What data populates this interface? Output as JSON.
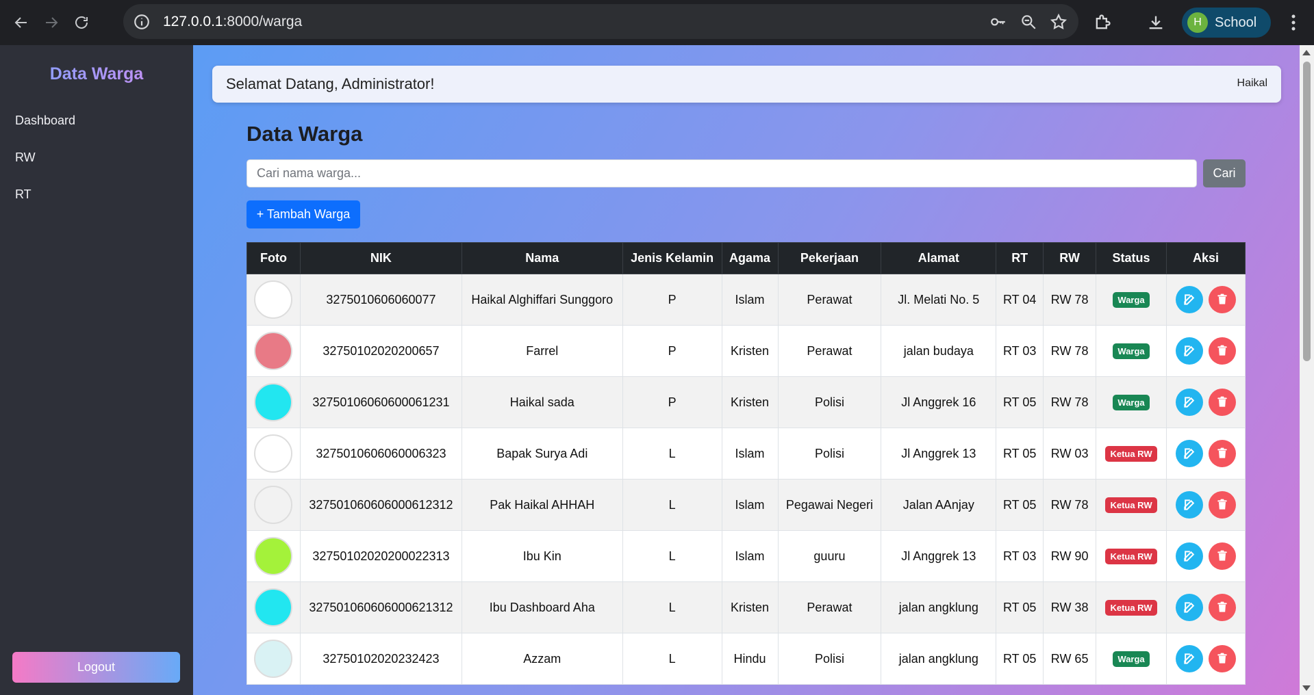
{
  "browser": {
    "url_host": "127.0.0.1",
    "url_path": ":8000/warga",
    "profile_initial": "H",
    "profile_name": "School"
  },
  "sidebar": {
    "brand": "Data Warga",
    "items": [
      {
        "label": "Dashboard"
      },
      {
        "label": "RW"
      },
      {
        "label": "RT"
      }
    ],
    "logout": "Logout"
  },
  "topbar": {
    "welcome": "Selamat Datang, Administrator!",
    "user": "Haikal"
  },
  "main": {
    "title": "Data Warga",
    "search_placeholder": "Cari nama warga...",
    "search_button": "Cari",
    "add_button": "+ Tambah Warga"
  },
  "table": {
    "headers": [
      "Foto",
      "NIK",
      "Nama",
      "Jenis Kelamin",
      "Agama",
      "Pekerjaan",
      "Alamat",
      "RT",
      "RW",
      "Status",
      "Aksi"
    ],
    "rows": [
      {
        "nik": "3275010606060077",
        "nama": "Haikal Alghiffari Sunggoro",
        "jk": "P",
        "agama": "Islam",
        "pekerjaan": "Perawat",
        "alamat": "Jl. Melati No. 5",
        "rt": "RT 04",
        "rw": "RW 78",
        "status": "Warga",
        "photo": "white"
      },
      {
        "nik": "32750102020200657",
        "nama": "Farrel",
        "jk": "P",
        "agama": "Kristen",
        "pekerjaan": "Perawat",
        "alamat": "jalan budaya",
        "rt": "RT 03",
        "rw": "RW 78",
        "status": "Warga",
        "photo": "pink"
      },
      {
        "nik": "32750106060600061231",
        "nama": "Haikal sada",
        "jk": "P",
        "agama": "Kristen",
        "pekerjaan": "Polisi",
        "alamat": "Jl Anggrek 16",
        "rt": "RT 05",
        "rw": "RW 78",
        "status": "Warga",
        "photo": "cyan"
      },
      {
        "nik": "3275010606060006323",
        "nama": "Bapak Surya Adi",
        "jk": "L",
        "agama": "Islam",
        "pekerjaan": "Polisi",
        "alamat": "Jl Anggrek 13",
        "rt": "RT 05",
        "rw": "RW 03",
        "status": "Ketua RW",
        "photo": "white"
      },
      {
        "nik": "327501060606000612312",
        "nama": "Pak Haikal AHHAH",
        "jk": "L",
        "agama": "Islam",
        "pekerjaan": "Pegawai Negeri",
        "alamat": "Jalan AAnjay",
        "rt": "RT 05",
        "rw": "RW 78",
        "status": "Ketua RW",
        "photo": "gray"
      },
      {
        "nik": "32750102020200022313",
        "nama": "Ibu Kin",
        "jk": "L",
        "agama": "Islam",
        "pekerjaan": "guuru",
        "alamat": "Jl Anggrek 13",
        "rt": "RT 03",
        "rw": "RW 90",
        "status": "Ketua RW",
        "photo": "lime"
      },
      {
        "nik": "327501060606000621312",
        "nama": "Ibu Dashboard Aha",
        "jk": "L",
        "agama": "Kristen",
        "pekerjaan": "Perawat",
        "alamat": "jalan angklung",
        "rt": "RT 05",
        "rw": "RW 38",
        "status": "Ketua RW",
        "photo": "cyan"
      },
      {
        "nik": "32750102020232423",
        "nama": "Azzam",
        "jk": "L",
        "agama": "Hindu",
        "pekerjaan": "Polisi",
        "alamat": "jalan angklung",
        "rt": "RT 05",
        "rw": "RW 65",
        "status": "Warga",
        "photo": "building"
      }
    ]
  },
  "colors": {
    "status_warga": "#198754",
    "status_ketua": "#dc3545",
    "primary": "#0d6efd",
    "secondary": "#6c757d"
  },
  "icons": {
    "edit": "edit-icon",
    "delete": "trash-icon"
  }
}
